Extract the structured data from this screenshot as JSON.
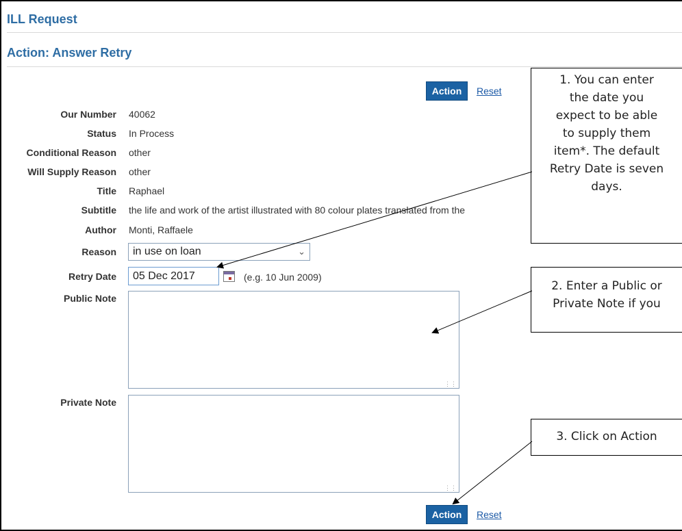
{
  "header": {
    "title": "ILL Request",
    "action_title": "Action: Answer Retry"
  },
  "buttons": {
    "action_label": "Action",
    "reset_label": "Reset"
  },
  "fields": {
    "our_number": {
      "label": "Our Number",
      "value": "40062"
    },
    "status": {
      "label": "Status",
      "value": "In Process"
    },
    "conditional_reason": {
      "label": "Conditional Reason",
      "value": "other"
    },
    "will_supply_reason": {
      "label": "Will Supply Reason",
      "value": "other"
    },
    "title": {
      "label": "Title",
      "value": "Raphael"
    },
    "subtitle": {
      "label": "Subtitle",
      "value": "the life and work of the artist illustrated with 80 colour plates translated from the"
    },
    "author": {
      "label": "Author",
      "value": "Monti, Raffaele"
    },
    "reason": {
      "label": "Reason",
      "value": "in use on loan"
    },
    "retry_date": {
      "label": "Retry Date",
      "value": "05 Dec 2017",
      "hint": "(e.g. 10 Jun 2009)"
    },
    "public_note": {
      "label": "Public Note",
      "value": ""
    },
    "private_note": {
      "label": "Private Note",
      "value": ""
    }
  },
  "callouts": {
    "c1": [
      "1. You can enter",
      "the date you",
      "expect to be able",
      "to supply them",
      "item*. The default",
      "Retry Date is seven",
      "days."
    ],
    "c2": [
      "2. Enter a Public or",
      "Private Note if you"
    ],
    "c3": [
      "3. Click on Action"
    ]
  },
  "icons": {
    "calendar": "calendar-icon",
    "dropdown": "chevron-down-icon",
    "resize": "resize-grip-icon"
  }
}
